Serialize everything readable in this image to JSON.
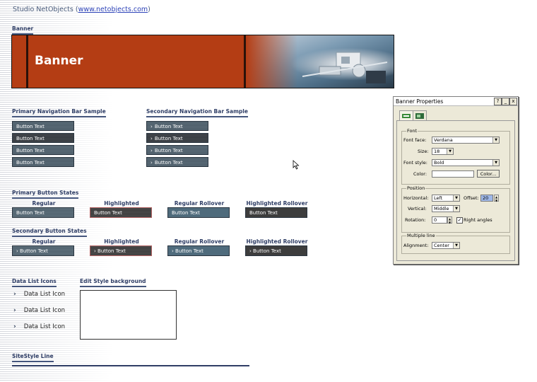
{
  "header": {
    "prefix": "Studio NetObjects (",
    "link": "www.netobjects.com",
    "suffix": ")"
  },
  "banner": {
    "section_title": "Banner",
    "text": "Banner"
  },
  "primary_nav": {
    "title": "Primary Navigation Bar Sample",
    "buttons": [
      "Button Text",
      "Button Text",
      "Button Text",
      "Button Text"
    ]
  },
  "secondary_nav": {
    "title": "Secondary Navigation Bar Sample",
    "buttons": [
      "Button Text",
      "Button Text",
      "Button Text",
      "Button Text"
    ]
  },
  "primary_states": {
    "title": "Primary Button States",
    "columns": [
      "Regular",
      "Highlighted",
      "Regular Rollover",
      "Highlighted Rollover"
    ],
    "buttons": [
      "Button Text",
      "Button Text",
      "Button Text",
      "Button Text"
    ]
  },
  "secondary_states": {
    "title": "Secondary Button States",
    "columns": [
      "Regular",
      "Highlighted",
      "Regular Rollover",
      "Highlighted Rollover"
    ],
    "buttons": [
      "Button Text",
      "Button Text",
      "Button Text",
      "Button Text"
    ]
  },
  "data_list": {
    "title": "Data List Icons",
    "items": [
      "Data List Icon",
      "Data List Icon",
      "Data List Icon"
    ]
  },
  "edit_style": {
    "title": "Edit Style background"
  },
  "sitestyle": {
    "title": "SiteStyle Line"
  },
  "dialog": {
    "title": "Banner Properties",
    "title_buttons": [
      "?",
      "_",
      "x"
    ],
    "font_group": "Font",
    "font_face_label": "Font face:",
    "font_face_value": "Verdana",
    "size_label": "Size:",
    "size_value": "18",
    "font_style_label": "Font style:",
    "font_style_value": "Bold",
    "color_label": "Color:",
    "color_button": "Color...",
    "position_group": "Position",
    "horizontal_label": "Horizontal:",
    "horizontal_value": "Left",
    "offset_label": "Offset:",
    "offset_value": "20",
    "vertical_label": "Vertical:",
    "vertical_value": "Middle",
    "rotation_label": "Rotation:",
    "rotation_value": "0",
    "right_angles_label": "Right angles",
    "right_angles_checked": true,
    "multiline_group": "Multiple line",
    "alignment_label": "Alignment:",
    "alignment_value": "Center"
  }
}
